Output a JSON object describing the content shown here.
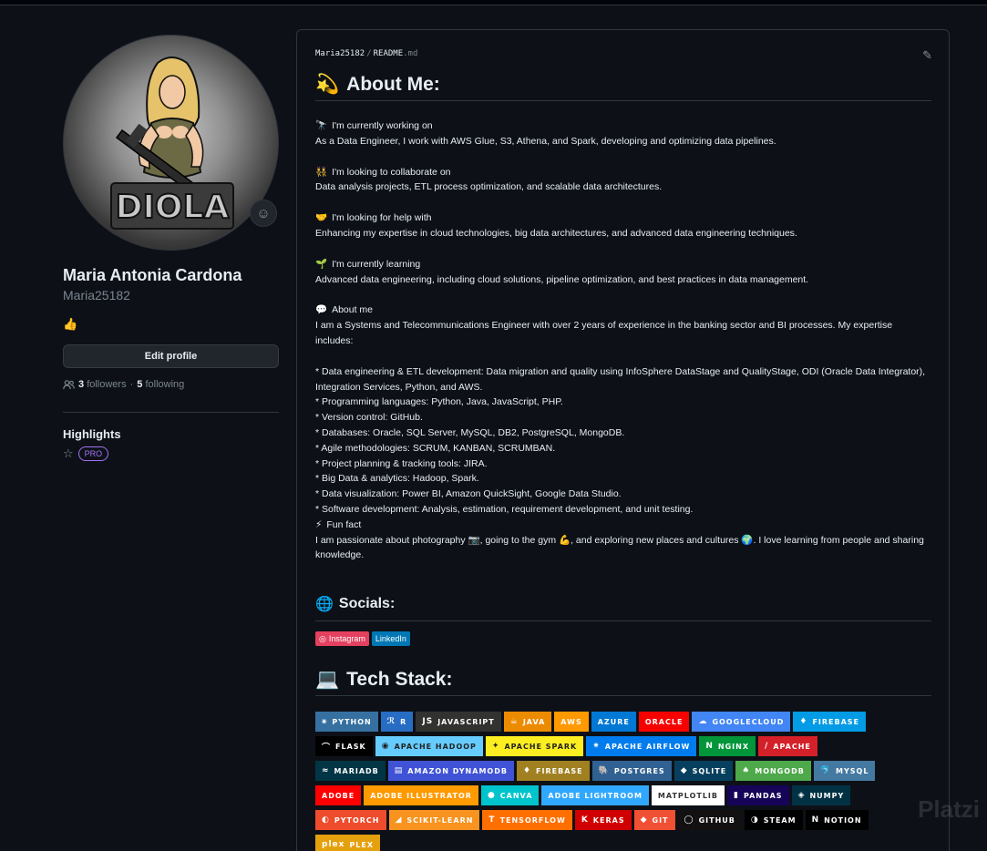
{
  "sidebar": {
    "avatar_text": "DIOLA",
    "fullname": "Maria Antonia Cardona",
    "username": "Maria25182",
    "bio_emoji": "👍",
    "edit_label": "Edit profile",
    "followers_count": "3",
    "followers_label": "followers",
    "separator": "·",
    "following_count": "5",
    "following_label": "following",
    "highlights_title": "Highlights",
    "pro_label": "PRO"
  },
  "readme": {
    "crumb_user": "Maria25182",
    "crumb_sep": "/",
    "crumb_file": "README",
    "crumb_ext": ".md",
    "about_title": "About Me:",
    "about_emoji": "💫",
    "sections": [
      {
        "emoji": "🔭",
        "title": "I'm currently working on",
        "text": "As a Data Engineer, I work with AWS Glue, S3, Athena, and Spark, developing and optimizing data pipelines."
      },
      {
        "emoji": "👯",
        "title": "I'm looking to collaborate on",
        "text": "Data analysis projects, ETL process optimization, and scalable data architectures."
      },
      {
        "emoji": "🤝",
        "title": "I'm looking for help with",
        "text": "Enhancing my expertise in cloud technologies, big data architectures, and advanced data engineering techniques."
      },
      {
        "emoji": "🌱",
        "title": "I'm currently learning",
        "text": "Advanced data engineering, including cloud solutions, pipeline optimization, and best practices in data management."
      }
    ],
    "about_me_emoji": "💬",
    "about_me_title": "About me",
    "about_me_intro": "I am a Systems and Telecommunications Engineer with over 2 years of experience in the banking sector and BI processes. My expertise includes:",
    "bullets": [
      "* Data engineering & ETL development: Data migration and quality using InfoSphere DataStage and QualityStage, ODI (Oracle Data Integrator), Integration Services, Python, and AWS.",
      "* Programming languages: Python, Java, JavaScript, PHP.",
      "* Version control: GitHub.",
      "* Databases: Oracle, SQL Server, MySQL, DB2, PostgreSQL, MongoDB.",
      "* Agile methodologies: SCRUM, KANBAN, SCRUMBAN.",
      "* Project planning & tracking tools: JIRA.",
      "* Big Data & analytics: Hadoop, Spark.",
      "* Data visualization: Power BI, Amazon QuickSight, Google Data Studio.",
      "* Software development: Analysis, estimation, requirement development, and unit testing."
    ],
    "fun_emoji": "⚡",
    "fun_title": "Fun fact",
    "fun_text": "I am passionate about photography 📷, going to the gym 💪, and exploring new places and cultures 🌍. I love learning from people and sharing knowledge.",
    "socials_title": "Socials:",
    "socials_emoji": "🌐",
    "socials": [
      {
        "label": "Instagram",
        "icon": "◎",
        "color": "#E4405F"
      },
      {
        "label": "LinkedIn",
        "icon": "",
        "color": "#0077B5"
      }
    ],
    "stack_title": "Tech Stack:",
    "stack_emoji": "💻",
    "stack_rows": [
      [
        {
          "label": "PYTHON",
          "icon": "⚹",
          "color": "#3670A0"
        },
        {
          "label": "R",
          "icon": "ℛ",
          "color": "#276DC3"
        },
        {
          "label": "JAVASCRIPT",
          "icon": "JS",
          "color": "#323330"
        },
        {
          "label": "JAVA",
          "icon": "☕",
          "color": "#ED8B00"
        },
        {
          "label": "AWS",
          "icon": "",
          "color": "#FF9900"
        },
        {
          "label": "AZURE",
          "icon": "",
          "color": "#0078D4"
        },
        {
          "label": "ORACLE",
          "icon": "",
          "color": "#F80000"
        },
        {
          "label": "GOOGLECLOUD",
          "icon": "☁",
          "color": "#4285F4"
        },
        {
          "label": "FIREBASE",
          "icon": "♦",
          "color": "#039BE5"
        }
      ],
      [
        {
          "label": "FLASK",
          "icon": "⌒",
          "color": "#000000"
        },
        {
          "label": "APACHE HADOOP",
          "icon": "◉",
          "color": "#66CCFF"
        },
        {
          "label": "APACHE SPARK",
          "icon": "✦",
          "color": "#FDEE21"
        },
        {
          "label": "APACHE AIRFLOW",
          "icon": "✷",
          "color": "#017CEE"
        },
        {
          "label": "NGINX",
          "icon": "N",
          "color": "#009639"
        },
        {
          "label": "APACHE",
          "icon": "/",
          "color": "#D42029"
        }
      ],
      [
        {
          "label": "MARIADB",
          "icon": "≈",
          "color": "#003545"
        },
        {
          "label": "AMAZON DYNAMODB",
          "icon": "▤",
          "color": "#4053D6"
        },
        {
          "label": "FIREBASE",
          "icon": "♦",
          "color": "#a08021"
        },
        {
          "label": "POSTGRES",
          "icon": "🐘",
          "color": "#316192"
        },
        {
          "label": "SQLITE",
          "icon": "◆",
          "color": "#07405e"
        },
        {
          "label": "MONGODB",
          "icon": "♠",
          "color": "#4ea94b"
        },
        {
          "label": "MYSQL",
          "icon": "🐬",
          "color": "#4479A1"
        }
      ],
      [
        {
          "label": "ADOBE",
          "icon": "",
          "color": "#FF0000"
        },
        {
          "label": "ADOBE ILLUSTRATOR",
          "icon": "",
          "color": "#FF9A00"
        },
        {
          "label": "CANVA",
          "icon": "●",
          "color": "#00C4CC"
        },
        {
          "label": "ADOBE LIGHTROOM",
          "icon": "",
          "color": "#31A8FF"
        },
        {
          "label": "MATPLOTLIB",
          "icon": "",
          "color": "#ffffff"
        },
        {
          "label": "PANDAS",
          "icon": "▮",
          "color": "#150458"
        },
        {
          "label": "NUMPY",
          "icon": "◈",
          "color": "#013243"
        }
      ],
      [
        {
          "label": "PYTORCH",
          "icon": "◐",
          "color": "#EE4C2C"
        },
        {
          "label": "SCIKIT-LEARN",
          "icon": "◢",
          "color": "#F7931E"
        },
        {
          "label": "TENSORFLOW",
          "icon": "T",
          "color": "#FF6F00"
        },
        {
          "label": "KERAS",
          "icon": "K",
          "color": "#D00000"
        },
        {
          "label": "GIT",
          "icon": "◆",
          "color": "#F05033"
        },
        {
          "label": "GITHUB",
          "icon": "◯",
          "color": "#121011"
        },
        {
          "label": "STEAM",
          "icon": "◑",
          "color": "#000000"
        },
        {
          "label": "NOTION",
          "icon": "N",
          "color": "#000000"
        }
      ],
      [
        {
          "label": "PLEX",
          "icon": "plex",
          "color": "#E5A00D"
        }
      ]
    ],
    "watermark": "Platzi"
  },
  "colors": {
    "bg": "#0d1117",
    "border": "#30363d",
    "muted": "#7d8590",
    "pro": "#a371f7"
  }
}
